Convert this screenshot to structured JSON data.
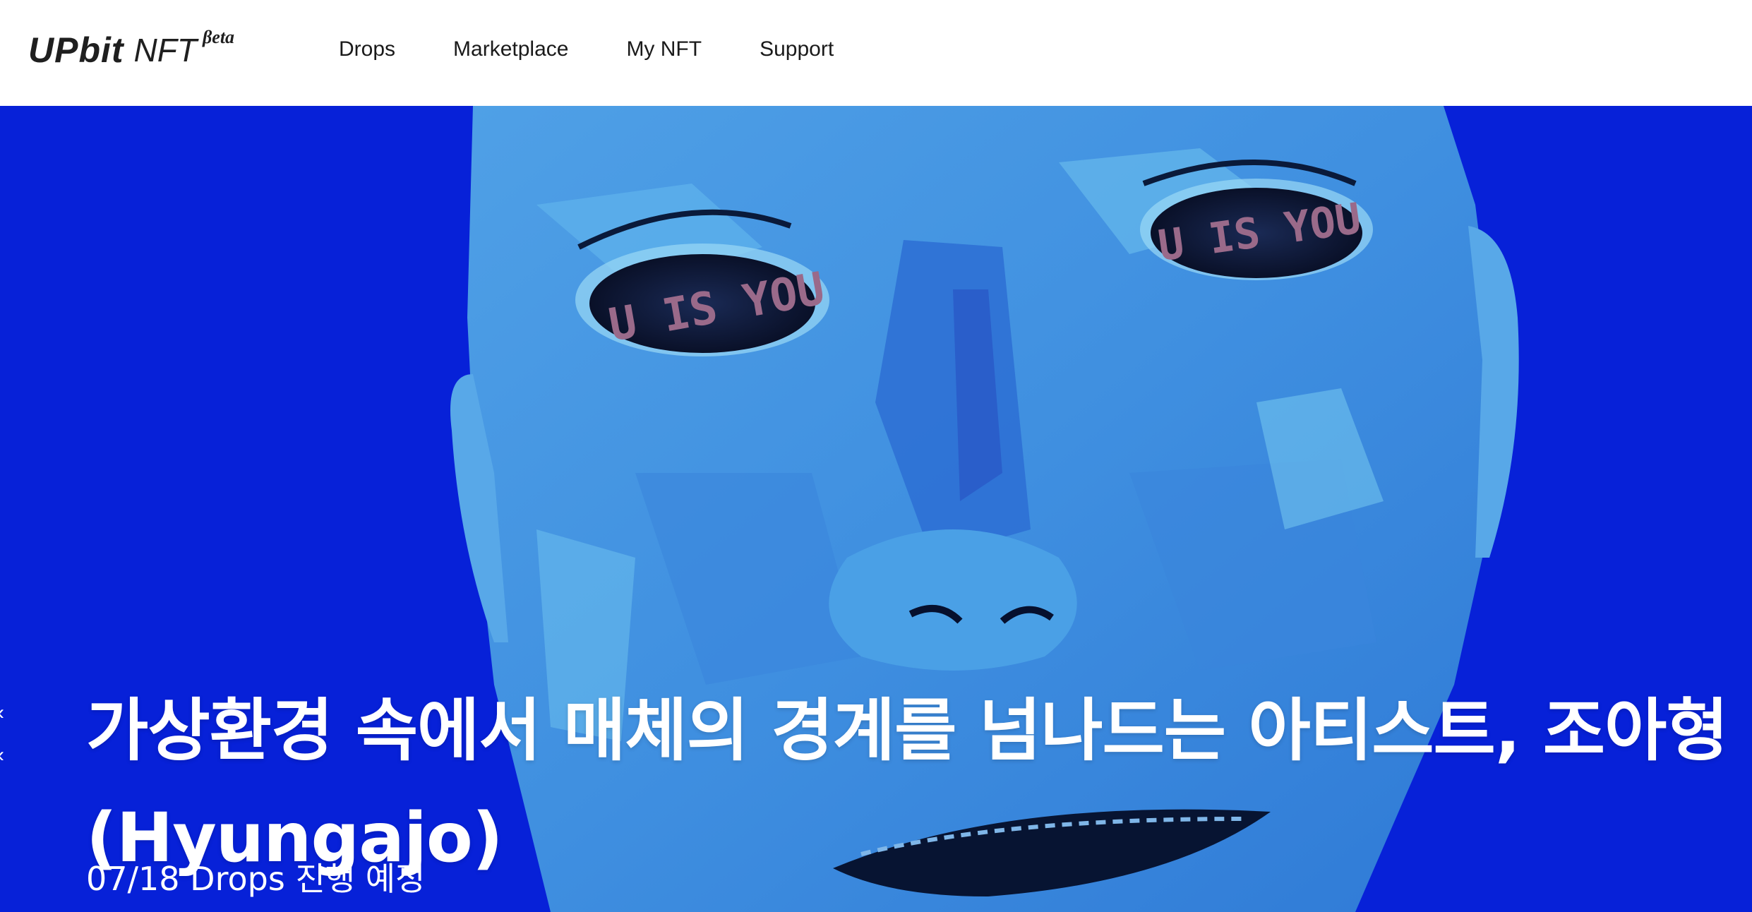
{
  "header": {
    "logo_main": "UPbit",
    "logo_sub": "NFT",
    "logo_beta": "βeta",
    "nav": [
      "Drops",
      "Marketplace",
      "My NFT",
      "Support"
    ]
  },
  "hero": {
    "title": "가상환경 속에서 매체의 경계를 넘나드는 아티스트, 조아형 (Hyungajo)",
    "subtitle": "07/18 Drops 진행 예정",
    "eye_text": "U IS YOU",
    "background_color": "#0721d8"
  }
}
